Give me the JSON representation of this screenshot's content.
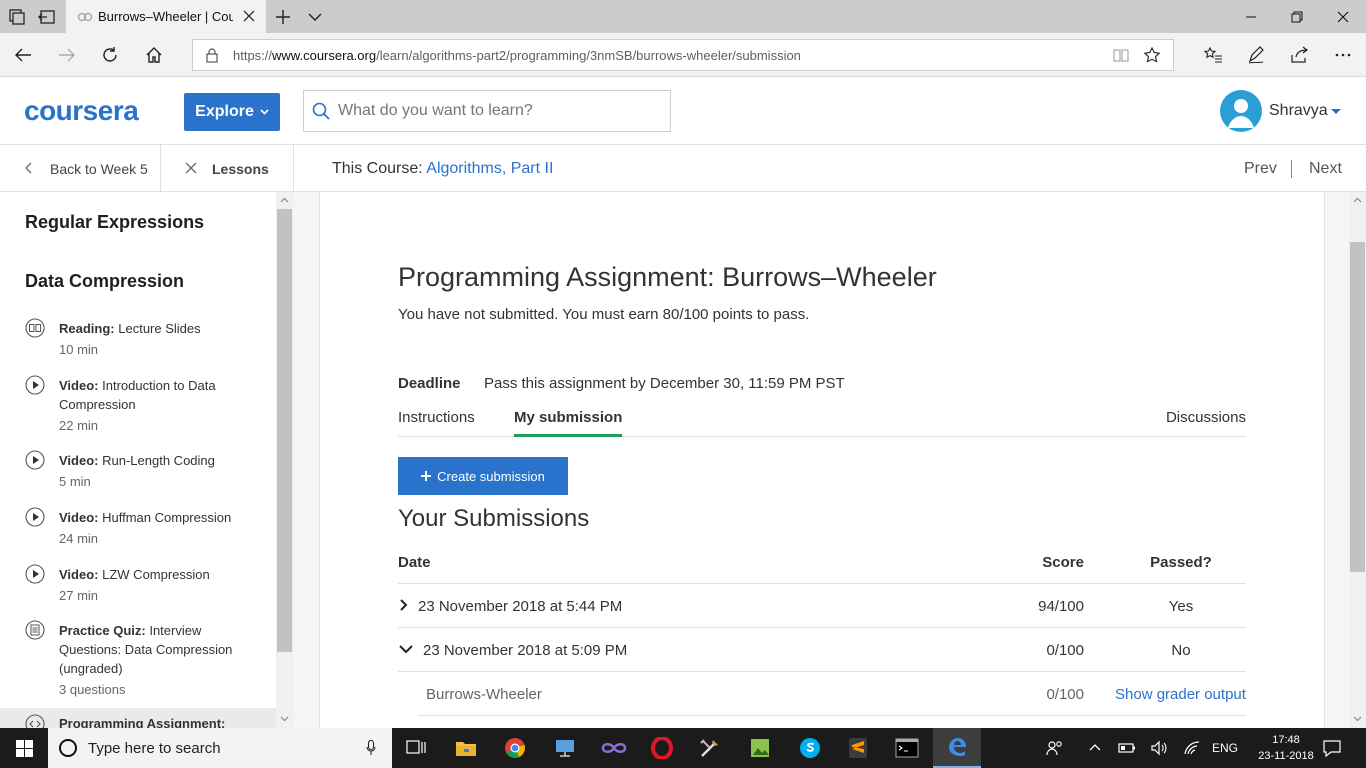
{
  "browser": {
    "tab_title": "Burrows–Wheeler | Coursera",
    "url_prefix": "https://",
    "url_domain": "www.coursera.org",
    "url_path": "/learn/algorithms-part2/programming/3nmSB/burrows-wheeler/submission"
  },
  "header": {
    "logo": "coursera",
    "explore_label": "Explore",
    "search_placeholder": "What do you want to learn?",
    "user_name": "Shravya"
  },
  "course_nav": {
    "back_label": "Back to Week 5",
    "lessons_label": "Lessons",
    "this_course_prefix": "This Course:",
    "course_name": "Algorithms, Part II",
    "prev_label": "Prev",
    "next_label": "Next"
  },
  "sidebar": {
    "section_1": "Regular Expressions",
    "section_2": "Data Compression",
    "items": [
      {
        "type": "Reading:",
        "title": "Lecture Slides",
        "duration": "10 min",
        "icon": "book-icon"
      },
      {
        "type": "Video:",
        "title": "Introduction to Data Compression",
        "duration": "22 min",
        "icon": "play-icon"
      },
      {
        "type": "Video:",
        "title": "Run-Length Coding",
        "duration": "5 min",
        "icon": "play-icon"
      },
      {
        "type": "Video:",
        "title": "Huffman Compression",
        "duration": "24 min",
        "icon": "play-icon"
      },
      {
        "type": "Video:",
        "title": "LZW Compression",
        "duration": "27 min",
        "icon": "play-icon"
      },
      {
        "type": "Practice Quiz:",
        "title": "Interview Questions: Data Compression (ungraded)",
        "duration": "3 questions",
        "icon": "quiz-icon"
      },
      {
        "type": "Programming Assignment:",
        "title": "",
        "duration": "",
        "icon": "code-icon"
      }
    ]
  },
  "assignment": {
    "title": "Programming Assignment: Burrows–Wheeler",
    "subtitle": "You have not submitted. You must earn 80/100 points to pass.",
    "deadline_label": "Deadline",
    "deadline_text": "Pass this assignment by December 30, 11:59 PM PST",
    "tabs": [
      "Instructions",
      "My submission",
      "Discussions"
    ],
    "create_label": "Create submission",
    "submissions_heading": "Your Submissions"
  },
  "submissions_table": {
    "headers": {
      "date": "Date",
      "score": "Score",
      "passed": "Passed?"
    },
    "rows": [
      {
        "date": "23 November 2018 at 5:44 PM",
        "score": "94/100",
        "passed": "Yes",
        "expanded": false
      },
      {
        "date": "23 November 2018 at 5:09 PM",
        "score": "0/100",
        "passed": "No",
        "expanded": true
      }
    ],
    "sub_row": {
      "part": "Burrows-Wheeler",
      "score": "0/100",
      "link": "Show grader output"
    }
  },
  "taskbar": {
    "search_text": "Type here to search",
    "language": "ENG",
    "time": "17:48",
    "date": "23-11-2018"
  },
  "colors": {
    "accent": "#2a73cc",
    "tab_underline": "#1f9e5a"
  }
}
